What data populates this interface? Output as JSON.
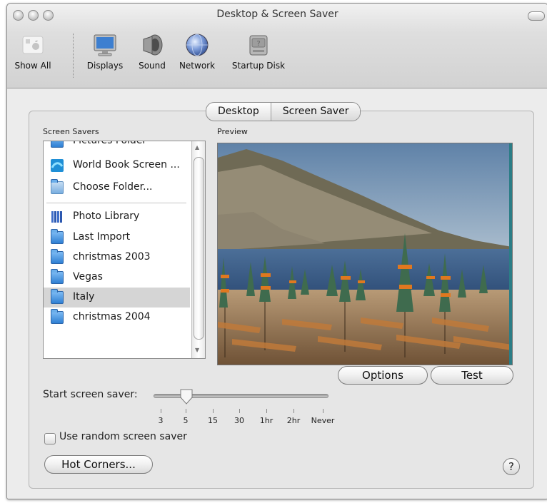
{
  "window": {
    "title": "Desktop & Screen Saver"
  },
  "toolbar": {
    "items": [
      {
        "label": "Show All",
        "icon": "apple-icon"
      },
      {
        "label": "Displays",
        "icon": "display-icon"
      },
      {
        "label": "Sound",
        "icon": "speaker-icon"
      },
      {
        "label": "Network",
        "icon": "globe-icon"
      },
      {
        "label": "Startup Disk",
        "icon": "disk-icon"
      }
    ]
  },
  "tabs": [
    {
      "label": "Desktop",
      "selected": false
    },
    {
      "label": "Screen Saver",
      "selected": true
    }
  ],
  "screen_savers": {
    "label": "Screen Savers",
    "items": [
      {
        "label": "Pictures Folder",
        "icon": "folder-icon"
      },
      {
        "label": "World Book Screen ...",
        "icon": "world-book-icon"
      },
      {
        "label": "Choose Folder...",
        "icon": "folder-icon"
      },
      {
        "label": "Photo Library",
        "icon": "photo-library-icon"
      },
      {
        "label": "Last Import",
        "icon": "folder-icon"
      },
      {
        "label": "christmas 2003",
        "icon": "folder-icon"
      },
      {
        "label": "Vegas",
        "icon": "folder-icon"
      },
      {
        "label": "Italy",
        "icon": "folder-icon",
        "selected": true
      },
      {
        "label": "christmas 2004",
        "icon": "folder-icon"
      }
    ]
  },
  "preview": {
    "label": "Preview"
  },
  "buttons": {
    "options": "Options",
    "test": "Test",
    "hot_corners": "Hot Corners...",
    "help": "?"
  },
  "start_saver": {
    "label": "Start screen saver:",
    "ticks": [
      "3",
      "5",
      "15",
      "30",
      "1hr",
      "2hr",
      "Never"
    ],
    "selected": "5"
  },
  "random": {
    "label": "Use random screen saver",
    "checked": false
  },
  "colors": {
    "selection": "#d5d5d5",
    "folder_blue": "#2e7fd3",
    "window_bg": "#ececec"
  }
}
